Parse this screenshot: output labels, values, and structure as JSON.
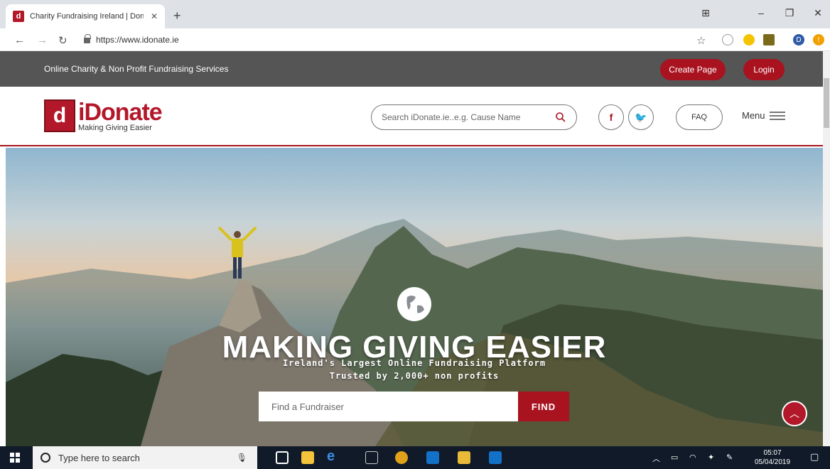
{
  "browser": {
    "tab_title": "Charity Fundraising Ireland | Don",
    "url": "https://www.idonate.ie",
    "profile_initial": "D"
  },
  "topstrip": {
    "text": "Online Charity & Non Profit Fundraising Services",
    "create_page": "Create Page",
    "login": "Login"
  },
  "header": {
    "logo_name": "iDonate",
    "logo_tagline": "Making Giving Easier",
    "search_placeholder": "Search iDonate.ie..e.g. Cause Name",
    "faq": "FAQ",
    "menu": "Menu"
  },
  "hero": {
    "title": "MAKING GIVING EASIER",
    "subtitle1": "Ireland's Largest Online Fundraising Platform",
    "subtitle2": "Trusted by 2,000+ non profits",
    "find_placeholder": "Find a Fundraiser",
    "find_button": "FIND"
  },
  "taskbar": {
    "search_text": "Type here to search",
    "time": "05:07",
    "date": "05/04/2019"
  },
  "colors": {
    "brand_red": "#a8131f",
    "strip_grey": "#555555",
    "taskbar": "#101a28"
  }
}
